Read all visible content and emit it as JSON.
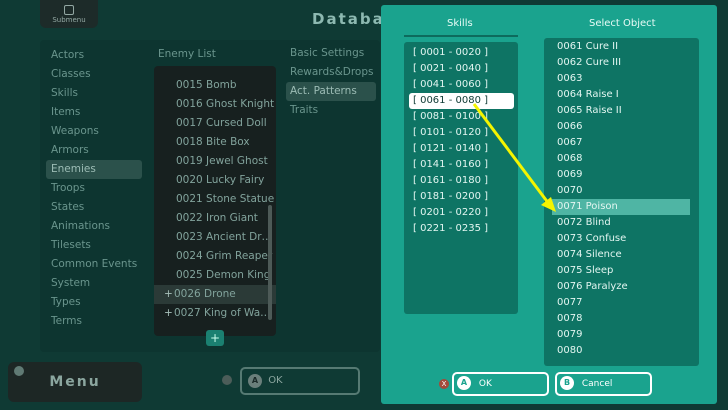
{
  "background": {
    "submenu_label": "Submenu",
    "title": "Databas",
    "categories": [
      "Actors",
      "Classes",
      "Skills",
      "Items",
      "Weapons",
      "Armors",
      "Enemies",
      "Troops",
      "States",
      "Animations",
      "Tilesets",
      "Common Events",
      "System",
      "Types",
      "Terms"
    ],
    "selected_category": "Enemies",
    "enemy_list_title": "Enemy List",
    "enemies": [
      "0015 Bomb",
      "0016 Ghost Knight",
      "0017 Cursed Doll",
      "0018 Bite Box",
      "0019 Jewel Ghost",
      "0020 Lucky Fairy",
      "0021 Stone Statue",
      "0022 Iron Giant",
      "0023 Ancient Dr…",
      "0024 Grim Reaper",
      "0025 Demon King",
      "0026 Drone",
      "0027 King of Wa…"
    ],
    "tabs": [
      "Basic Settings",
      "Rewards&Drops",
      "Act. Patterns",
      "Traits"
    ],
    "selected_tab": "Act. Patterns",
    "menu_label": "Menu",
    "ok_label": "OK",
    "ok_key": "A"
  },
  "dialog": {
    "skills_title": "Skills",
    "ranges": [
      "[ 0001 - 0020 ]",
      "[ 0021 - 0040 ]",
      "[ 0041 - 0060 ]",
      "[ 0061 - 0080 ]",
      "[ 0081 - 0100 ]",
      "[ 0101 - 0120 ]",
      "[ 0121 - 0140 ]",
      "[ 0141 - 0160 ]",
      "[ 0161 - 0180 ]",
      "[ 0181 - 0200 ]",
      "[ 0201 - 0220 ]",
      "[ 0221 - 0235 ]"
    ],
    "selected_range": "[ 0061 - 0080 ]",
    "object_title": "Select Object",
    "objects": [
      "0061 Cure II",
      "0062 Cure III",
      "0063",
      "0064 Raise I",
      "0065 Raise II",
      "0066",
      "0067",
      "0068",
      "0069",
      "0070",
      "0071 Poison",
      "0072 Blind",
      "0073 Confuse",
      "0074 Silence",
      "0075 Sleep",
      "0076 Paralyze",
      "0077",
      "0078",
      "0079",
      "0080"
    ],
    "selected_object": "0071 Poison",
    "ok_label": "OK",
    "ok_key": "A",
    "cancel_label": "Cancel",
    "cancel_key": "B",
    "close_key": "X"
  },
  "colors": {
    "dialog_bg": "#1aa38e",
    "arrow": "#f4f400"
  }
}
